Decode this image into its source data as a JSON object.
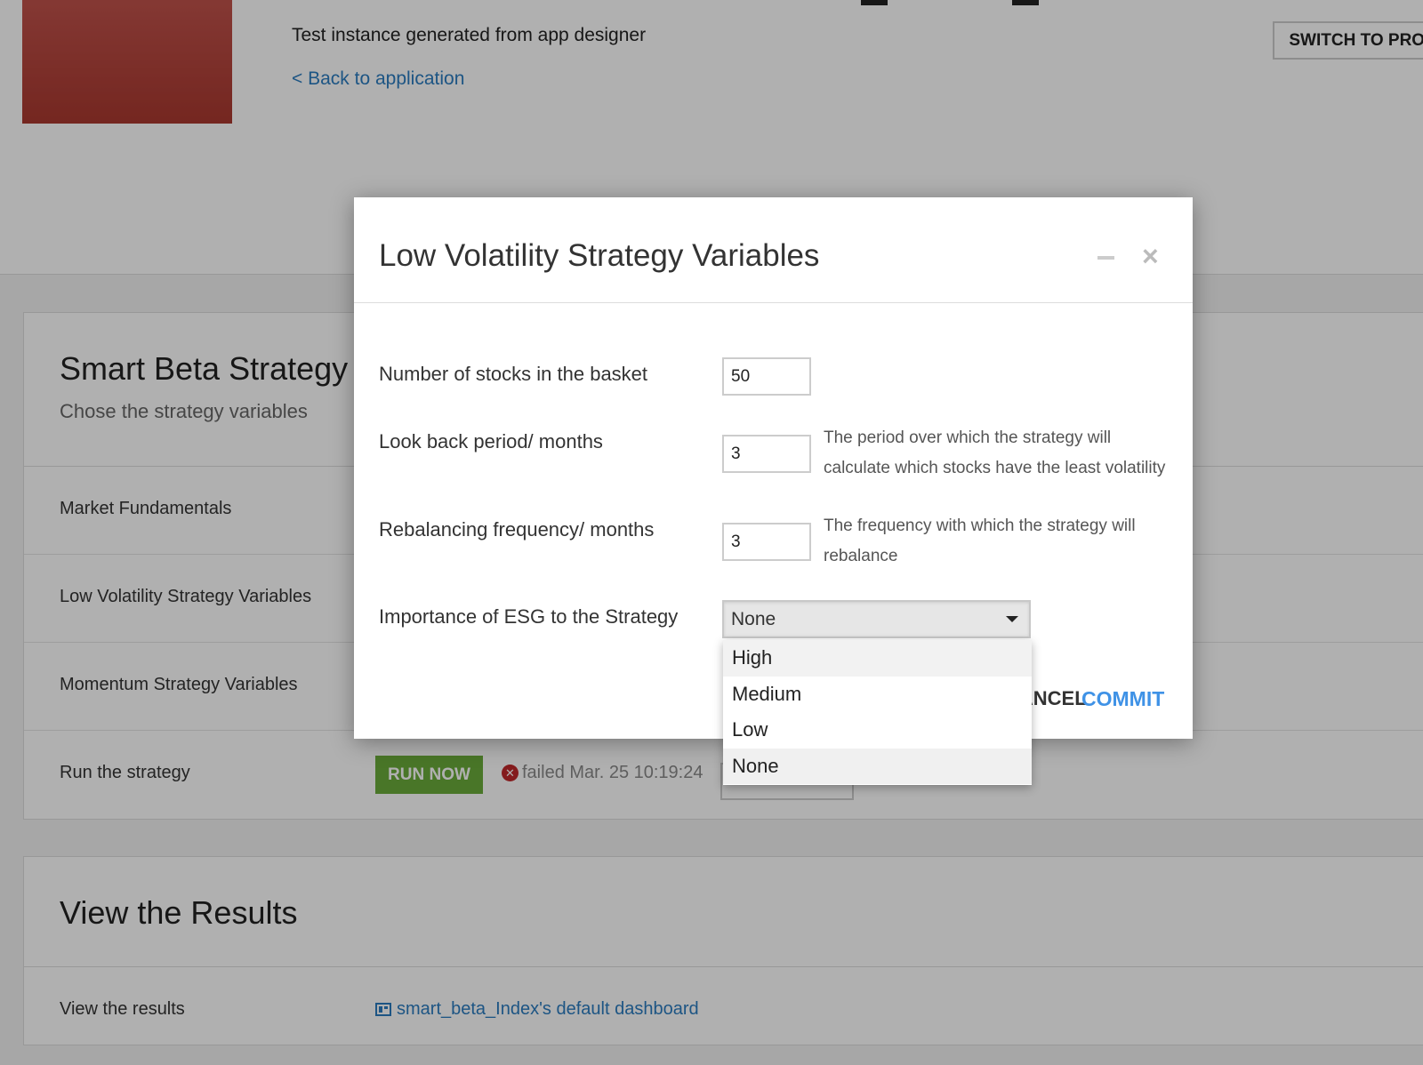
{
  "header": {
    "subtitle": "Test instance generated from app designer",
    "back_link": "< Back to application",
    "switch_button": "SWITCH TO PROJ"
  },
  "strategy_card": {
    "title": "Smart Beta Strategy",
    "subtitle": "Chose the strategy variables",
    "rows": [
      {
        "label": "Market Fundamentals"
      },
      {
        "label": "Low Volatility Strategy Variables"
      },
      {
        "label": "Momentum Strategy Variables"
      },
      {
        "label": "Run the strategy"
      }
    ],
    "run_button": "RUN NOW",
    "run_status": "failed Mar. 25 10:19:24",
    "status_icon": "error-circle-icon"
  },
  "results_card": {
    "title": "View the Results",
    "row_label": "View the results",
    "dashboard_link": "smart_beta_Index's default dashboard",
    "dashboard_icon": "dashboard-icon"
  },
  "modal": {
    "title": "Low Volatility Strategy Variables",
    "minimize_icon": "minimize-icon",
    "close_label": "×",
    "fields": [
      {
        "label": "Number of stocks in the basket",
        "value": "50",
        "help": ""
      },
      {
        "label": "Look back period/ months",
        "value": "3",
        "help": "The period over which the strategy will calculate which stocks have the least volatility"
      },
      {
        "label": "Rebalancing frequency/ months",
        "value": "3",
        "help": "The frequency with which the strategy will rebalance"
      }
    ],
    "select": {
      "label": "Importance of ESG to the Strategy",
      "value": "None",
      "options": [
        "High",
        "Medium",
        "Low",
        "None"
      ]
    },
    "cancel_label": "CANCEL",
    "commit_label": "COMMIT"
  },
  "colors": {
    "accent_blue": "#3f92e6",
    "link_blue": "#2a7bbf",
    "run_green": "#6bab3a",
    "error_red": "#c0282b",
    "logo_red": "#a9382f"
  }
}
